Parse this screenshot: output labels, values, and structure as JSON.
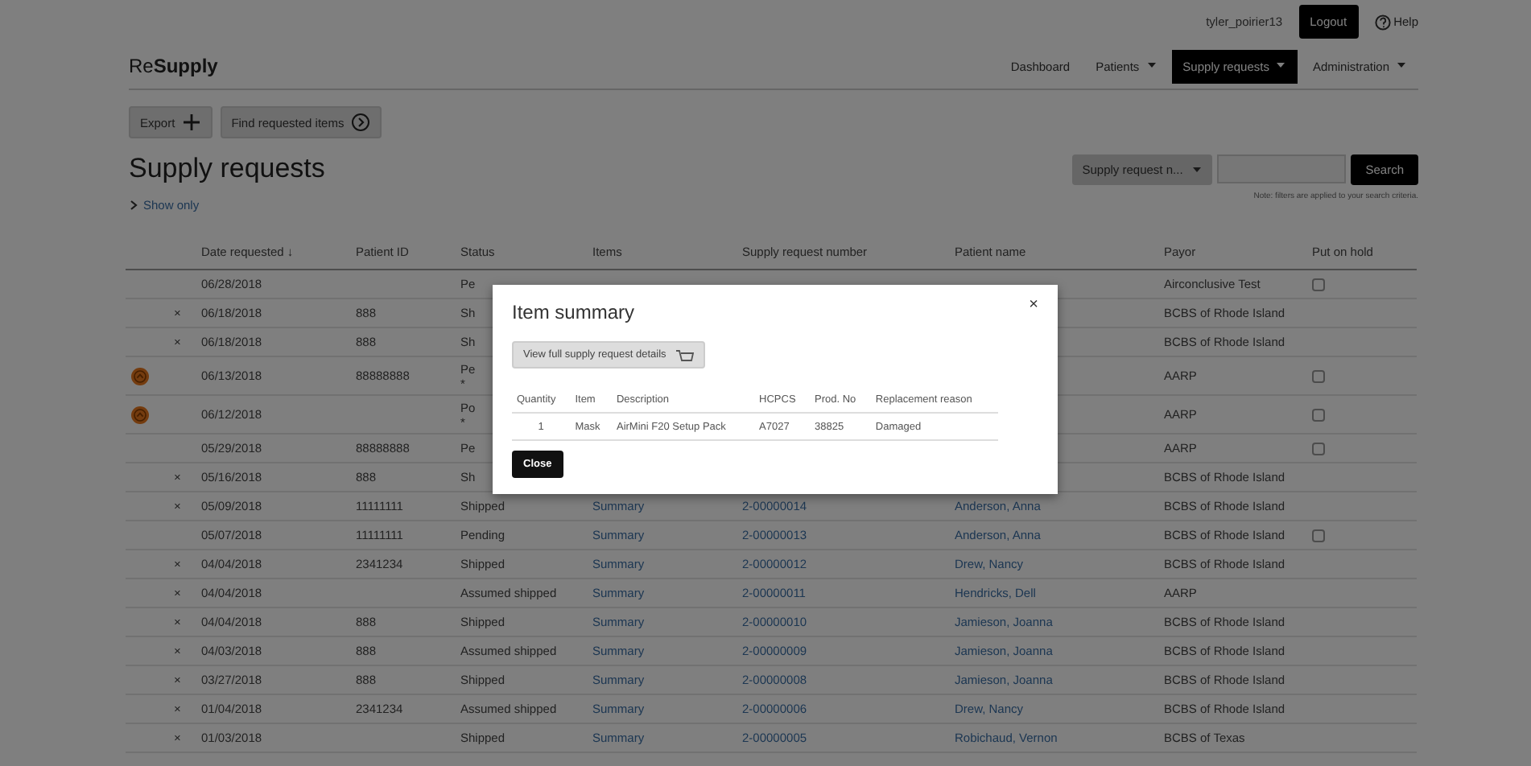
{
  "top_bar": {
    "username": "tyler_poirier13",
    "logout": "Logout",
    "help": "Help"
  },
  "nav": {
    "logo": "Re**Supply**",
    "items": [
      {
        "label": "Dashboard",
        "dropdown": false,
        "selected": false
      },
      {
        "label": "Patients",
        "dropdown": true,
        "selected": false
      },
      {
        "label": "Supply requests",
        "dropdown": true,
        "selected": true
      },
      {
        "label": "Administration",
        "dropdown": true,
        "selected": false
      }
    ]
  },
  "toolbar": {
    "buttons": [
      {
        "label": "Export",
        "kind": "plus"
      },
      {
        "label": "Find requested items",
        "kind": "chevron"
      }
    ]
  },
  "heading": {
    "title": "Supply requests",
    "show_only": "Show only",
    "search_type": "Supply request n...",
    "search_button": "Search",
    "note": "Note: filters are applied to your search criteria."
  },
  "table": {
    "columns": [
      "Date requested",
      "Patient ID",
      "Status",
      "Items",
      "Supply request number",
      "Patient name",
      "Payor",
      "Put on hold"
    ],
    "sort_indicator": "↓",
    "rows": [
      {
        "alert": false,
        "mark": "",
        "date": "06/28/2018",
        "patient_id": "",
        "status": "Pe",
        "items": "",
        "number": "",
        "name": "",
        "payor": "Airconclusive Test",
        "hold": {
          "checked": false
        }
      },
      {
        "alert": false,
        "mark": "×",
        "date": "06/18/2018",
        "patient_id": "888",
        "status": "Sh",
        "items": "",
        "number": "",
        "name": "",
        "payor": "BCBS of Rhode Island"
      },
      {
        "alert": false,
        "mark": "×",
        "date": "06/18/2018",
        "patient_id": "888",
        "status": "Sh",
        "items": "",
        "number": "",
        "name": "",
        "payor": "BCBS of Rhode Island"
      },
      {
        "alert": true,
        "mark": "",
        "date": "06/13/2018",
        "patient_id": "88888888",
        "status": "Pe",
        "status_note": "*",
        "items": "",
        "number": "",
        "name": "",
        "payor": "AARP",
        "hold": {
          "checked": false
        }
      },
      {
        "alert": true,
        "mark": "",
        "date": "06/12/2018",
        "patient_id": "",
        "status": "Po",
        "status_note": "*",
        "items": "",
        "number": "",
        "name": "",
        "payor": "AARP",
        "hold": {
          "checked": false
        }
      },
      {
        "alert": false,
        "mark": "",
        "date": "05/29/2018",
        "patient_id": "88888888",
        "status": "Pe",
        "items": "",
        "number": "",
        "name": "",
        "payor": "AARP",
        "hold": {
          "checked": false
        }
      },
      {
        "alert": false,
        "mark": "×",
        "date": "05/16/2018",
        "patient_id": "888",
        "status": "Sh",
        "items": "",
        "number": "",
        "name": "",
        "payor": "BCBS of Rhode Island"
      },
      {
        "alert": false,
        "mark": "×",
        "date": "05/09/2018",
        "patient_id": "11111111",
        "status": "Shipped",
        "items": "Summary",
        "number": "2-00000014",
        "name": "Anderson, Anna",
        "payor": "BCBS of Rhode Island"
      },
      {
        "alert": false,
        "mark": "",
        "date": "05/07/2018",
        "patient_id": "11111111",
        "status": "Pending",
        "items": "Summary",
        "number": "2-00000013",
        "name": "Anderson, Anna",
        "payor": "BCBS of Rhode Island",
        "hold": {
          "checked": false
        }
      },
      {
        "alert": false,
        "mark": "×",
        "date": "04/04/2018",
        "patient_id": "2341234",
        "status": "Shipped",
        "items": "Summary",
        "number": "2-00000012",
        "name": "Drew, Nancy",
        "payor": "BCBS of Rhode Island"
      },
      {
        "alert": false,
        "mark": "×",
        "date": "04/04/2018",
        "patient_id": "",
        "status": "Assumed shipped",
        "items": "Summary",
        "number": "2-00000011",
        "name": "Hendricks, Dell",
        "payor": "AARP"
      },
      {
        "alert": false,
        "mark": "×",
        "date": "04/04/2018",
        "patient_id": "888",
        "status": "Shipped",
        "items": "Summary",
        "number": "2-00000010",
        "name": "Jamieson, Joanna",
        "payor": "BCBS of Rhode Island"
      },
      {
        "alert": false,
        "mark": "×",
        "date": "04/03/2018",
        "patient_id": "888",
        "status": "Assumed shipped",
        "items": "Summary",
        "number": "2-00000009",
        "name": "Jamieson, Joanna",
        "payor": "BCBS of Rhode Island"
      },
      {
        "alert": false,
        "mark": "×",
        "date": "03/27/2018",
        "patient_id": "888",
        "status": "Shipped",
        "items": "Summary",
        "number": "2-00000008",
        "name": "Jamieson, Joanna",
        "payor": "BCBS of Rhode Island"
      },
      {
        "alert": false,
        "mark": "×",
        "date": "01/04/2018",
        "patient_id": "2341234",
        "status": "Assumed shipped",
        "items": "Summary",
        "number": "2-00000006",
        "name": "Drew, Nancy",
        "payor": "BCBS of Rhode Island"
      },
      {
        "alert": false,
        "mark": "×",
        "date": "01/03/2018",
        "patient_id": "",
        "status": "Shipped",
        "items": "Summary",
        "number": "2-00000005",
        "name": "Robichaud, Vernon",
        "payor": "BCBS of Texas"
      }
    ]
  },
  "modal": {
    "title": "Item summary",
    "close_icon": "×",
    "details_button": "View full supply request details",
    "columns": [
      "Quantity",
      "Item",
      "Description",
      "HCPCS",
      "Prod. No",
      "Replacement reason"
    ],
    "rows": [
      [
        "1",
        "Mask",
        "AirMini F20 Setup Pack",
        "A7027",
        "38825",
        "Damaged"
      ]
    ],
    "close_button": "Close"
  }
}
